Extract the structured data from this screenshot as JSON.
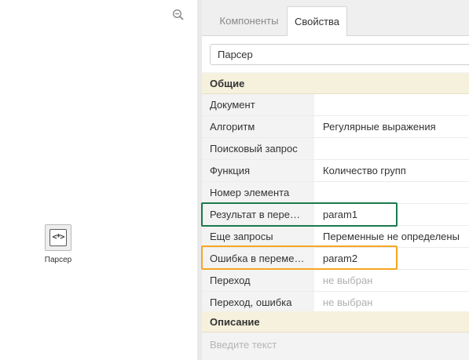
{
  "canvas": {
    "zoom_icon": "zoom-out-icon",
    "node": {
      "icon_glyph": "<*>",
      "label": "Парсер"
    }
  },
  "tabs": [
    {
      "label": "Компоненты",
      "active": false
    },
    {
      "label": "Свойства",
      "active": true
    }
  ],
  "name_field": {
    "value": "Парсер"
  },
  "sections": {
    "general": "Общие",
    "description": "Описание"
  },
  "properties": [
    {
      "key": "Документ",
      "value": ""
    },
    {
      "key": "Алгоритм",
      "value": "Регулярные выражения"
    },
    {
      "key": "Поисковый запрос",
      "value": ""
    },
    {
      "key": "Функция",
      "value": "Количество групп"
    },
    {
      "key": "Номер элемента",
      "value": ""
    },
    {
      "key": "Результат в пере…",
      "value": "param1"
    },
    {
      "key": "Еще запросы",
      "value": "Переменные не определены"
    },
    {
      "key": "Ошибка в переме…",
      "value": "param2"
    },
    {
      "key": "Переход",
      "value": "не выбран"
    },
    {
      "key": "Переход, ошибка",
      "value": "не выбран"
    }
  ],
  "description": {
    "placeholder": "Введите текст"
  },
  "colors": {
    "highlight_green": "#1a7a4c",
    "highlight_orange": "#f5a623",
    "section_bg": "#f6f1dd",
    "muted_text": "#b0b0b0"
  }
}
